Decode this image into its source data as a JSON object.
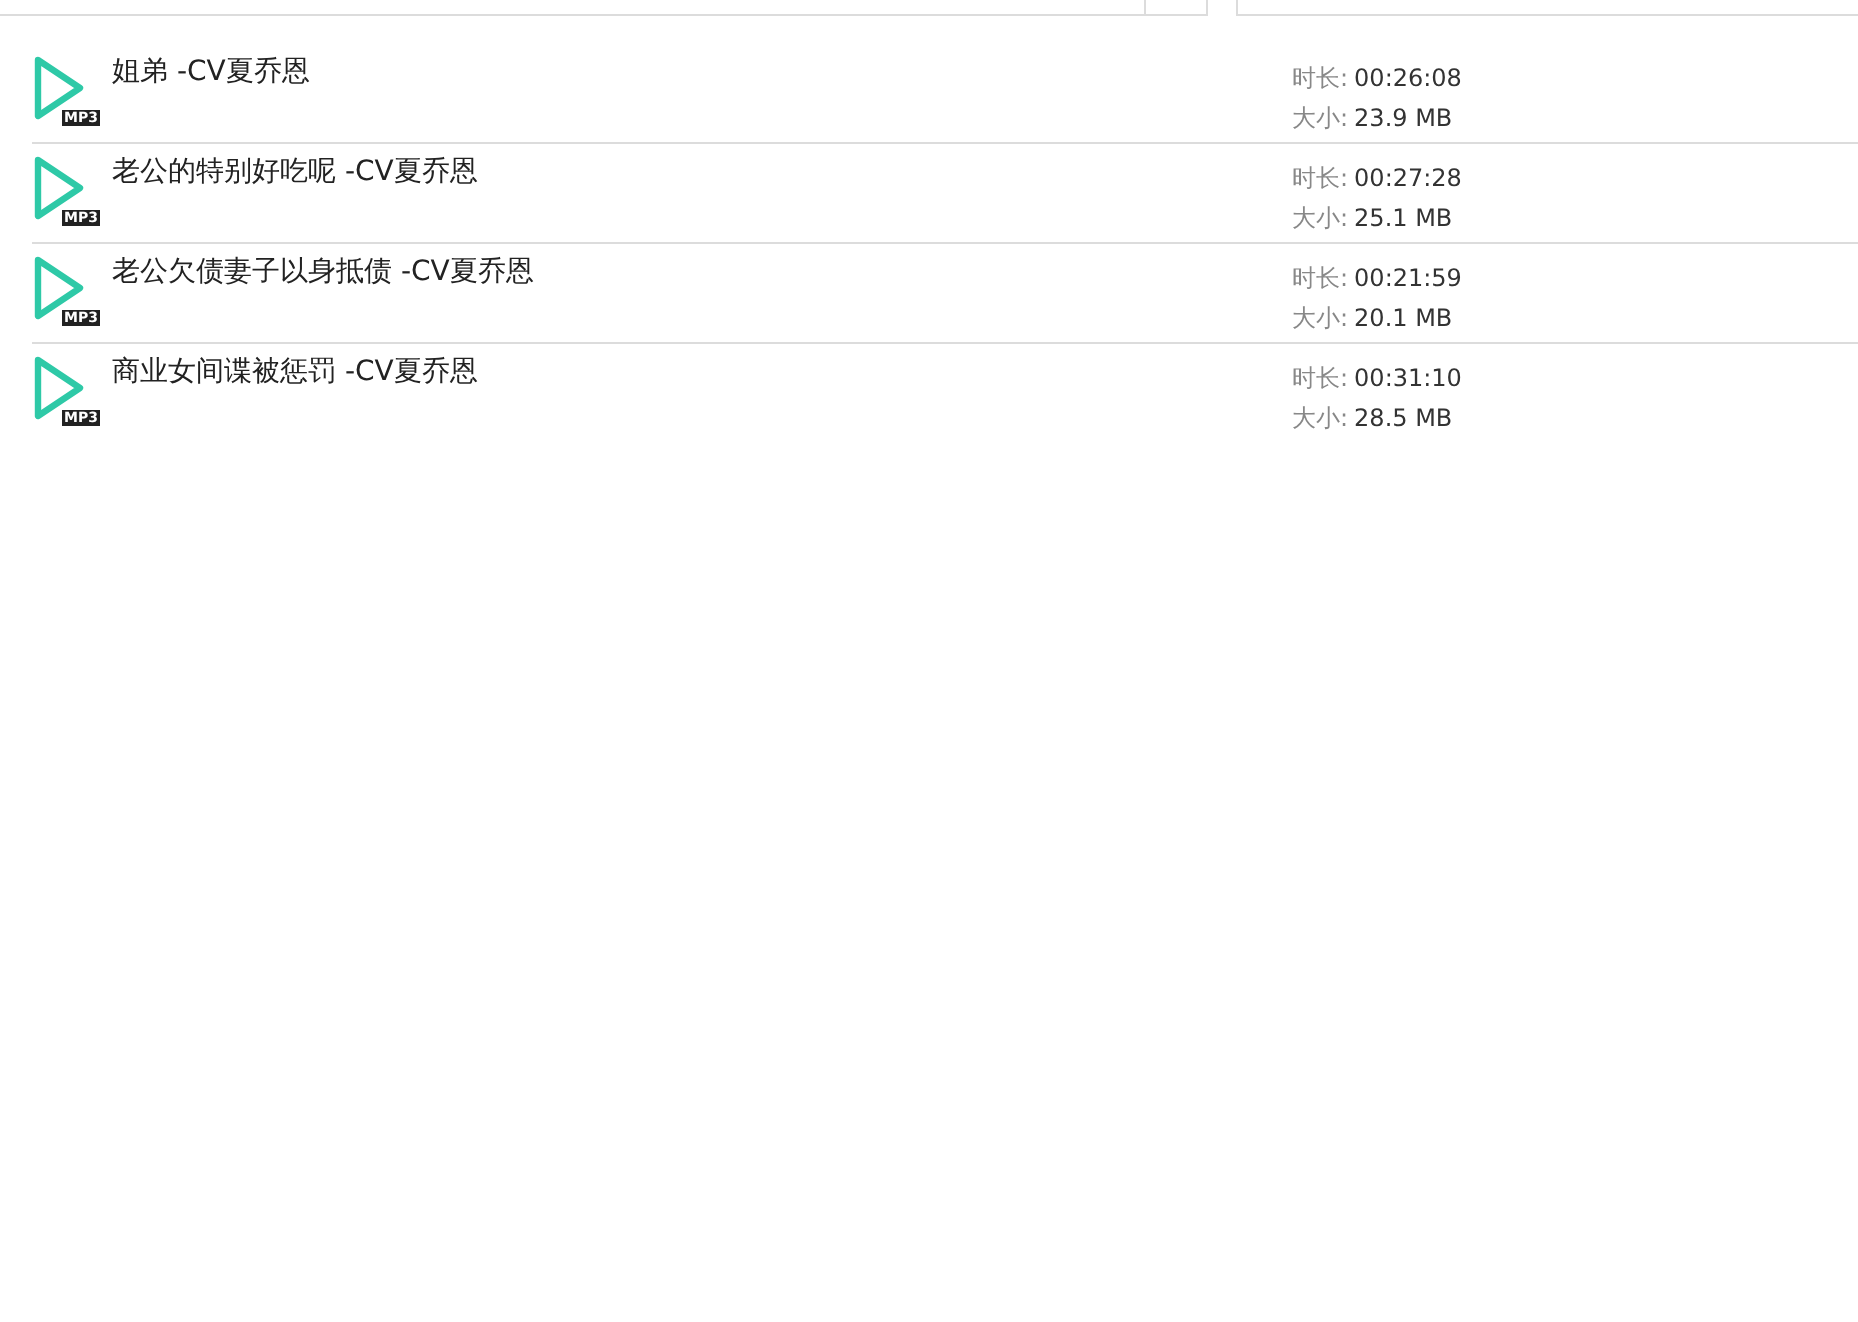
{
  "files": [
    {
      "title": "姐弟 -CV夏乔恩",
      "badge": "MP3",
      "duration_label": "时长:",
      "duration": "00:26:08",
      "size_label": "大小:",
      "size": "23.9 MB"
    },
    {
      "title": "老公的特别好吃呢 -CV夏乔恩",
      "badge": "MP3",
      "duration_label": "时长:",
      "duration": "00:27:28",
      "size_label": "大小:",
      "size": "25.1 MB"
    },
    {
      "title": "老公欠债妻子以身抵债 -CV夏乔恩",
      "badge": "MP3",
      "duration_label": "时长:",
      "duration": "00:21:59",
      "size_label": "大小:",
      "size": "20.1 MB"
    },
    {
      "title": "商业女间谍被惩罚 -CV夏乔恩",
      "badge": "MP3",
      "duration_label": "时长:",
      "duration": "00:31:10",
      "size_label": "大小:",
      "size": "28.5 MB"
    }
  ]
}
